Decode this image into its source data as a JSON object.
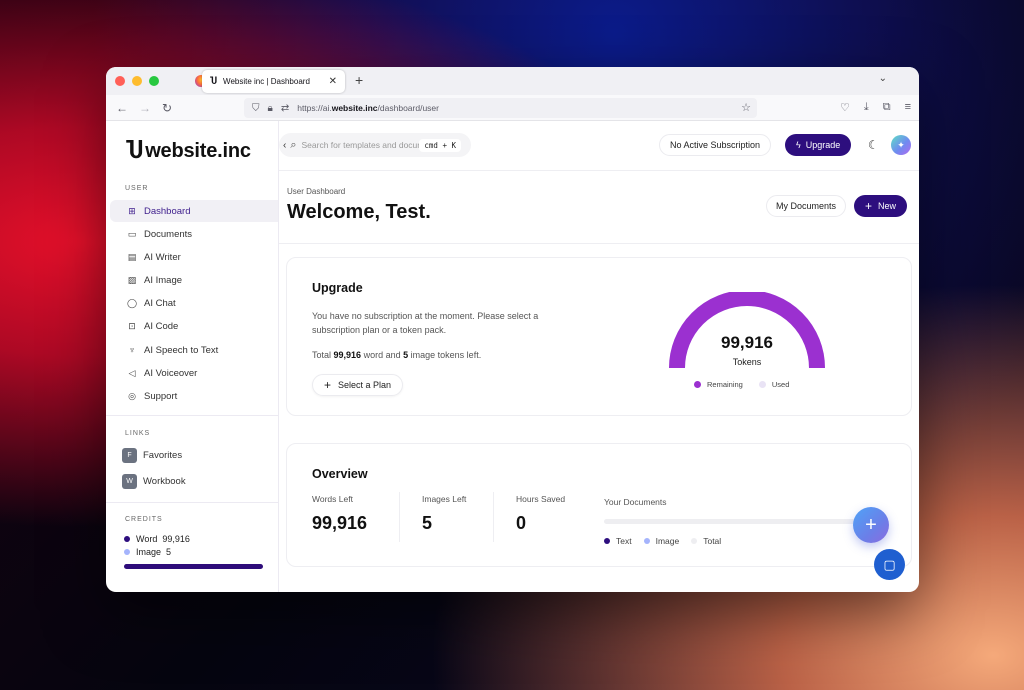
{
  "browser": {
    "tab_title": "Website inc | Dashboard",
    "tab_icon": "Ⴎ",
    "url_prefix": "https://ai.",
    "url_domain": "website.inc",
    "url_path": "/dashboard/user"
  },
  "brand": {
    "mark": "Ⴎ",
    "name": "website.inc"
  },
  "sidebar": {
    "user_label": "USER",
    "items": [
      {
        "label": "Dashboard",
        "icon": "grid-icon",
        "active": true
      },
      {
        "label": "Documents",
        "icon": "archive-icon"
      },
      {
        "label": "AI Writer",
        "icon": "file-icon"
      },
      {
        "label": "AI Image",
        "icon": "image-icon"
      },
      {
        "label": "AI Chat",
        "icon": "chat-icon"
      },
      {
        "label": "AI Code",
        "icon": "terminal-icon"
      },
      {
        "label": "AI Speech to Text",
        "icon": "mic-icon"
      },
      {
        "label": "AI Voiceover",
        "icon": "speaker-icon"
      },
      {
        "label": "Support",
        "icon": "lifebuoy-icon"
      }
    ],
    "links_label": "LINKS",
    "links": [
      {
        "badge": "F",
        "label": "Favorites"
      },
      {
        "badge": "W",
        "label": "Workbook"
      }
    ],
    "credits_label": "CREDITS",
    "credits": [
      {
        "label": "Word",
        "value": "99,916",
        "color": "#2d0e7e"
      },
      {
        "label": "Image",
        "value": "5",
        "color": "#a5b4fc"
      }
    ]
  },
  "topbar": {
    "search_placeholder": "Search for templates and documents...",
    "shortcut": "cmd + K",
    "subscription_label": "No Active Subscription",
    "upgrade_label": "Upgrade"
  },
  "header": {
    "breadcrumb": "User Dashboard",
    "title": "Welcome, Test.",
    "my_documents": "My Documents",
    "new_label": "New"
  },
  "upgrade_card": {
    "title": "Upgrade",
    "text": "You have no subscription at the moment. Please select a subscription plan or a token pack.",
    "tokens_prefix": "Total",
    "word_tokens": "99,916",
    "tokens_mid": "word and",
    "image_tokens": "5",
    "tokens_suffix": "image tokens left.",
    "select_plan": "Select a Plan",
    "gauge_value": "99,916",
    "gauge_label": "Tokens",
    "gauge_remaining_fraction": 1.0,
    "legend_remaining": "Remaining",
    "legend_used": "Used",
    "color_remaining": "#9b30d0",
    "color_used": "#e9e3f5"
  },
  "overview": {
    "title": "Overview",
    "stats": [
      {
        "label": "Words Left",
        "value": "99,916"
      },
      {
        "label": "Images Left",
        "value": "5"
      },
      {
        "label": "Hours Saved",
        "value": "0"
      }
    ],
    "docs_label": "Your Documents",
    "docs_legend": [
      {
        "label": "Text",
        "color": "#2d0e7e"
      },
      {
        "label": "Image",
        "color": "#a5b4fc"
      },
      {
        "label": "Total",
        "color": "#eeeef1"
      }
    ]
  }
}
